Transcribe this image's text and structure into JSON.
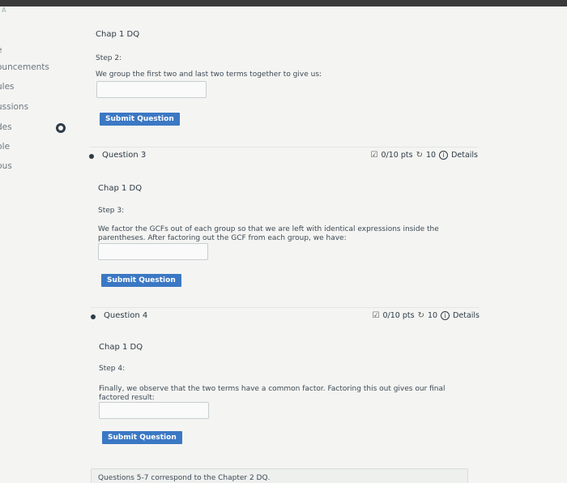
{
  "topbar": {
    "corner_text": "A"
  },
  "sidebar": {
    "items": [
      {
        "label": "e"
      },
      {
        "label": "ouncements"
      },
      {
        "label": "ules"
      },
      {
        "label": "ussions"
      },
      {
        "label": "des"
      },
      {
        "label": "ple"
      },
      {
        "label": "bus"
      }
    ]
  },
  "blocks": [
    {
      "title": "Chap 1 DQ",
      "step": "Step 2:",
      "prompt": "We group the first two and last two terms together to give us:",
      "answer_value": "",
      "submit_label": "Submit Question"
    },
    {
      "title": "Chap 1 DQ",
      "step": "Step 3:",
      "prompt": "We factor the GCFs out of each group so that we are left with identical expressions inside the parentheses. After factoring out the GCF from each group, we have:",
      "answer_value": "",
      "submit_label": "Submit Question"
    },
    {
      "title": "Chap 1 DQ",
      "step": "Step 4:",
      "prompt": "Finally, we observe that the two terms have a common factor. Factoring this out gives our final factored result:",
      "answer_value": "",
      "submit_label": "Submit Question"
    }
  ],
  "questions": [
    {
      "title": "Question 3",
      "points": "0/10 pts",
      "attempts": "10",
      "details_label": "Details"
    },
    {
      "title": "Question 4",
      "points": "0/10 pts",
      "attempts": "10",
      "details_label": "Details"
    }
  ],
  "icons": {
    "pts": "edit-icon",
    "attempts": "retry-icon",
    "details": "info-icon"
  },
  "footer": {
    "text": "Questions 5-7 correspond to the Chapter 2 DQ."
  },
  "colors": {
    "accent": "#3b78c4",
    "text": "#2d3b45",
    "background": "#f4f4f2"
  }
}
